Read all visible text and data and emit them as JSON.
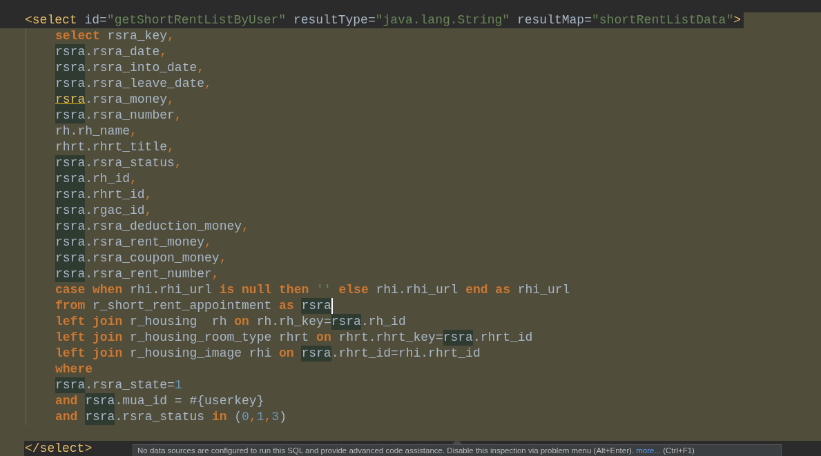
{
  "editor": {
    "lines": [
      {
        "kind": "tag-open",
        "tokens": [
          {
            "kind": "tag",
            "text": "<select"
          },
          {
            "kind": "plain",
            "text": " id="
          },
          {
            "kind": "string",
            "text": "\"getShortRentListByUser\""
          },
          {
            "kind": "plain",
            "text": " resultType="
          },
          {
            "kind": "string",
            "text": "\"java.lang.String\""
          },
          {
            "kind": "plain",
            "text": " resultMap="
          },
          {
            "kind": "string",
            "text": "\"shortRentListData\""
          },
          {
            "kind": "tag",
            "text": ">"
          }
        ]
      },
      {
        "kind": "code",
        "tokens": [
          {
            "kind": "keyword",
            "text": "select"
          },
          {
            "kind": "plain",
            "text": " rsra_key"
          },
          {
            "kind": "punct",
            "text": ","
          }
        ]
      },
      {
        "kind": "code",
        "tokens": [
          {
            "kind": "ref",
            "text": "rsra"
          },
          {
            "kind": "plain",
            "text": ".rsra_date"
          },
          {
            "kind": "punct",
            "text": ","
          }
        ]
      },
      {
        "kind": "code",
        "tokens": [
          {
            "kind": "ref",
            "text": "rsra"
          },
          {
            "kind": "plain",
            "text": ".rsra_into_date"
          },
          {
            "kind": "punct",
            "text": ","
          }
        ]
      },
      {
        "kind": "code",
        "tokens": [
          {
            "kind": "ref",
            "text": "rsra"
          },
          {
            "kind": "plain",
            "text": ".rsra_leave_date"
          },
          {
            "kind": "punct",
            "text": ","
          }
        ]
      },
      {
        "kind": "code",
        "tokens": [
          {
            "kind": "ref-underlined",
            "text": "rsra"
          },
          {
            "kind": "plain",
            "text": ".rsra_money"
          },
          {
            "kind": "punct",
            "text": ","
          }
        ]
      },
      {
        "kind": "code",
        "tokens": [
          {
            "kind": "ref",
            "text": "rsra"
          },
          {
            "kind": "plain",
            "text": ".rsra_number"
          },
          {
            "kind": "punct",
            "text": ","
          }
        ]
      },
      {
        "kind": "code",
        "tokens": [
          {
            "kind": "plain",
            "text": "rh.rh_name"
          },
          {
            "kind": "punct",
            "text": ","
          }
        ]
      },
      {
        "kind": "code",
        "tokens": [
          {
            "kind": "plain",
            "text": "rhrt.rhrt_title"
          },
          {
            "kind": "punct",
            "text": ","
          }
        ]
      },
      {
        "kind": "code",
        "tokens": [
          {
            "kind": "ref",
            "text": "rsra"
          },
          {
            "kind": "plain",
            "text": ".rsra_status"
          },
          {
            "kind": "punct",
            "text": ","
          }
        ]
      },
      {
        "kind": "code",
        "tokens": [
          {
            "kind": "ref",
            "text": "rsra"
          },
          {
            "kind": "plain",
            "text": ".rh_id"
          },
          {
            "kind": "punct",
            "text": ","
          }
        ]
      },
      {
        "kind": "code",
        "tokens": [
          {
            "kind": "ref",
            "text": "rsra"
          },
          {
            "kind": "plain",
            "text": ".rhrt_id"
          },
          {
            "kind": "punct",
            "text": ","
          }
        ]
      },
      {
        "kind": "code",
        "tokens": [
          {
            "kind": "ref",
            "text": "rsra"
          },
          {
            "kind": "plain",
            "text": ".rgac_id"
          },
          {
            "kind": "punct",
            "text": ","
          }
        ]
      },
      {
        "kind": "code",
        "tokens": [
          {
            "kind": "ref",
            "text": "rsra"
          },
          {
            "kind": "plain",
            "text": ".rsra_deduction_money"
          },
          {
            "kind": "punct",
            "text": ","
          }
        ]
      },
      {
        "kind": "code",
        "tokens": [
          {
            "kind": "ref",
            "text": "rsra"
          },
          {
            "kind": "plain",
            "text": ".rsra_rent_money"
          },
          {
            "kind": "punct",
            "text": ","
          }
        ]
      },
      {
        "kind": "code",
        "tokens": [
          {
            "kind": "ref",
            "text": "rsra"
          },
          {
            "kind": "plain",
            "text": ".rsra_coupon_money"
          },
          {
            "kind": "punct",
            "text": ","
          }
        ]
      },
      {
        "kind": "code",
        "tokens": [
          {
            "kind": "ref",
            "text": "rsra"
          },
          {
            "kind": "plain",
            "text": ".rsra_rent_number"
          },
          {
            "kind": "punct",
            "text": ","
          }
        ]
      },
      {
        "kind": "code",
        "tokens": [
          {
            "kind": "keyword",
            "text": "case when"
          },
          {
            "kind": "plain",
            "text": " rhi.rhi_url "
          },
          {
            "kind": "keyword",
            "text": "is null then "
          },
          {
            "kind": "string",
            "text": "''"
          },
          {
            "kind": "keyword",
            "text": " else"
          },
          {
            "kind": "plain",
            "text": " rhi.rhi_url "
          },
          {
            "kind": "keyword",
            "text": "end as"
          },
          {
            "kind": "plain",
            "text": " rhi_url"
          }
        ]
      },
      {
        "kind": "code",
        "tokens": [
          {
            "kind": "keyword",
            "text": "from"
          },
          {
            "kind": "plain",
            "text": " r_short_rent_appointment "
          },
          {
            "kind": "keyword",
            "text": "as "
          },
          {
            "kind": "ref-caret",
            "text": "rsra"
          }
        ]
      },
      {
        "kind": "code",
        "tokens": [
          {
            "kind": "keyword",
            "text": "left join"
          },
          {
            "kind": "plain",
            "text": " r_housing  rh "
          },
          {
            "kind": "keyword",
            "text": "on"
          },
          {
            "kind": "plain",
            "text": " rh.rh_key="
          },
          {
            "kind": "ref",
            "text": "rsra"
          },
          {
            "kind": "plain",
            "text": ".rh_id"
          }
        ]
      },
      {
        "kind": "code",
        "tokens": [
          {
            "kind": "keyword",
            "text": "left join"
          },
          {
            "kind": "plain",
            "text": " r_housing_room_type rhrt "
          },
          {
            "kind": "keyword",
            "text": "on"
          },
          {
            "kind": "plain",
            "text": " rhrt.rhrt_key="
          },
          {
            "kind": "ref",
            "text": "rsra"
          },
          {
            "kind": "plain",
            "text": ".rhrt_id"
          }
        ]
      },
      {
        "kind": "code",
        "tokens": [
          {
            "kind": "keyword",
            "text": "left join"
          },
          {
            "kind": "plain",
            "text": " r_housing_image rhi "
          },
          {
            "kind": "keyword",
            "text": "on "
          },
          {
            "kind": "ref",
            "text": "rsra"
          },
          {
            "kind": "plain",
            "text": ".rhrt_id=rhi.rhrt_id"
          }
        ]
      },
      {
        "kind": "code",
        "tokens": [
          {
            "kind": "keyword",
            "text": "where"
          }
        ]
      },
      {
        "kind": "code",
        "tokens": [
          {
            "kind": "ref",
            "text": "rsra"
          },
          {
            "kind": "plain",
            "text": ".rsra_state="
          },
          {
            "kind": "number",
            "text": "1"
          }
        ]
      },
      {
        "kind": "code",
        "tokens": [
          {
            "kind": "keyword",
            "text": "and "
          },
          {
            "kind": "ref",
            "text": "rsra"
          },
          {
            "kind": "plain",
            "text": ".mua_id = #{userkey}"
          }
        ]
      },
      {
        "kind": "code",
        "tokens": [
          {
            "kind": "keyword",
            "text": "and "
          },
          {
            "kind": "ref",
            "text": "rsra"
          },
          {
            "kind": "plain",
            "text": ".rsra_status "
          },
          {
            "kind": "keyword",
            "text": "in"
          },
          {
            "kind": "plain",
            "text": " ("
          },
          {
            "kind": "number",
            "text": "0"
          },
          {
            "kind": "punct",
            "text": ","
          },
          {
            "kind": "number",
            "text": "1"
          },
          {
            "kind": "punct",
            "text": ","
          },
          {
            "kind": "number",
            "text": "3"
          },
          {
            "kind": "plain",
            "text": ")"
          }
        ]
      },
      {
        "kind": "blank"
      },
      {
        "kind": "tag-close",
        "tokens": [
          {
            "kind": "tag",
            "text": "</select>"
          }
        ]
      }
    ]
  },
  "tooltip": {
    "message": "No data sources are configured to run this SQL and provide advanced code assistance. Disable this inspection via problem menu (Alt+Enter).",
    "link": "more...",
    "shortcut": "(Ctrl+F1)"
  }
}
